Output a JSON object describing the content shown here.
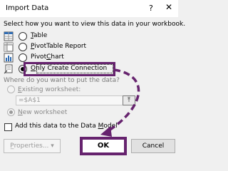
{
  "window": {
    "title": "Import Data",
    "help_label": "?",
    "close_label": "✕"
  },
  "view_section": {
    "prompt": "Select how you want to view this data in your workbook.",
    "options": [
      {
        "label_underlined": "T",
        "label_rest": "able",
        "selected": false
      },
      {
        "label_underlined": "P",
        "label_rest": "ivotTable Report",
        "selected": false
      },
      {
        "label_prefix": "Pivot",
        "label_underlined": "C",
        "label_rest": "hart",
        "selected": false
      },
      {
        "label_underlined": "O",
        "label_rest": "nly Create Connection",
        "selected": true
      }
    ]
  },
  "location_section": {
    "prompt": "Where do you want to put the data?",
    "existing_label_prefix": "E",
    "existing_label_rest": "xisting worksheet:",
    "cell_value": "=$A$1",
    "picker_icon": "⤒",
    "new_label_prefix": "N",
    "new_label_rest": "ew worksheet"
  },
  "data_model": {
    "label_prefix": "Add this data to the Data ",
    "label_underlined": "M",
    "label_rest": "odel",
    "checked": false
  },
  "buttons": {
    "properties_label": "P̲roperties...",
    "properties_arrow": "▾",
    "ok_label": "OK",
    "cancel_label": "Cancel"
  },
  "colors": {
    "highlight": "#66236e"
  }
}
